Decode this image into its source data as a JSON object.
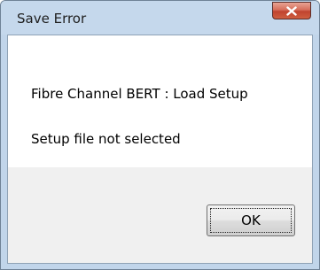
{
  "window": {
    "title": "Save Error",
    "close_icon": "close-x-icon"
  },
  "message": {
    "heading": "Fibre Channel BERT : Load Setup",
    "detail": "Setup file not selected"
  },
  "buttons": {
    "ok_label": "OK"
  },
  "colors": {
    "titlebar": "#c5d8ec",
    "close_button": "#c7503a",
    "client_background": "#f0f0f0",
    "content_background": "#ffffff"
  }
}
